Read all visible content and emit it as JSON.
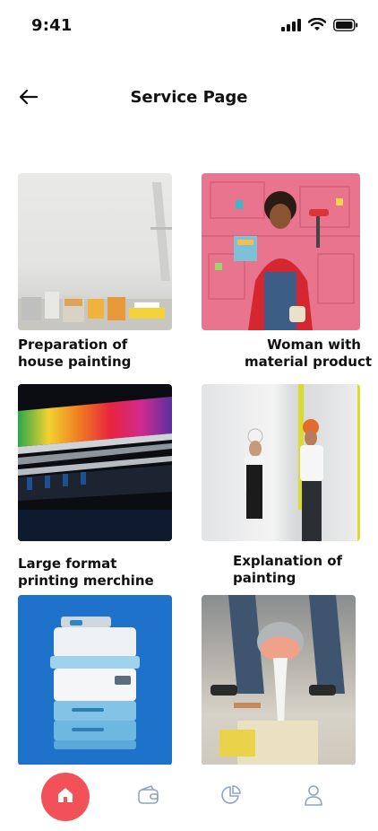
{
  "status_bar": {
    "time": "9:41"
  },
  "header": {
    "title": "Service Page"
  },
  "cards": [
    {
      "line1": "Preparation of",
      "line2": "house painting"
    },
    {
      "line1": "Woman with",
      "line2": "material product"
    },
    {
      "line1": "Large format",
      "line2": "printing merchine"
    },
    {
      "line1": "Explanation of",
      "line2": "painting"
    }
  ],
  "colors": {
    "accent": "#f2515a",
    "nav_icon": "#8fa3bf"
  },
  "bottom_nav": {
    "items": [
      "home-icon",
      "wallet-icon",
      "chart-icon",
      "profile-icon"
    ],
    "active": "home-icon"
  }
}
